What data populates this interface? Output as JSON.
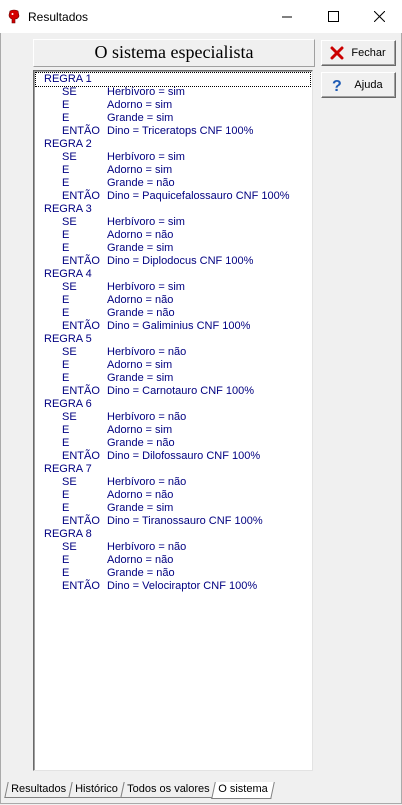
{
  "window": {
    "title": "Resultados"
  },
  "panel": {
    "heading": "O sistema especialista"
  },
  "buttons": {
    "close_label": "Fechar",
    "help_label": "Ajuda"
  },
  "tabs": [
    "Resultados",
    "Histórico",
    "Todos os valores",
    "O sistema"
  ],
  "colors": {
    "text_blue": "#000080",
    "close_x": "#cc0000",
    "help_q": "#1e5bb5"
  },
  "rules": [
    {
      "name": "REGRA 1",
      "if_kw": "SE",
      "and_kw": "E",
      "then_kw": "ENTÃO",
      "c1": "Herbívoro = sim",
      "c2": "Adorno = sim",
      "c3": "Grande = sim",
      "result": "Dino = Triceratops CNF 100%"
    },
    {
      "name": "REGRA 2",
      "if_kw": "SE",
      "and_kw": "E",
      "then_kw": "ENTÃO",
      "c1": "Herbívoro = sim",
      "c2": "Adorno = sim",
      "c3": "Grande = não",
      "result": "Dino = Paquicefalossauro CNF 100%"
    },
    {
      "name": "REGRA 3",
      "if_kw": "SE",
      "and_kw": "E",
      "then_kw": "ENTÃO",
      "c1": "Herbívoro = sim",
      "c2": "Adorno = não",
      "c3": "Grande = sim",
      "result": "Dino = Diplodocus CNF 100%"
    },
    {
      "name": "REGRA 4",
      "if_kw": "SE",
      "and_kw": "E",
      "then_kw": "ENTÃO",
      "c1": "Herbívoro = sim",
      "c2": "Adorno = não",
      "c3": "Grande = não",
      "result": "Dino = Galiminius CNF 100%"
    },
    {
      "name": "REGRA 5",
      "if_kw": "SE",
      "and_kw": "E",
      "then_kw": "ENTÃO",
      "c1": "Herbívoro = não",
      "c2": "Adorno = sim",
      "c3": "Grande = sim",
      "result": "Dino = Carnotauro CNF 100%"
    },
    {
      "name": "REGRA 6",
      "if_kw": "SE",
      "and_kw": "E",
      "then_kw": "ENTÃO",
      "c1": "Herbívoro = não",
      "c2": "Adorno = sim",
      "c3": "Grande = não",
      "result": "Dino = Dilofossauro CNF 100%"
    },
    {
      "name": "REGRA 7",
      "if_kw": "SE",
      "and_kw": "E",
      "then_kw": "ENTÃO",
      "c1": "Herbívoro = não",
      "c2": "Adorno = não",
      "c3": "Grande = sim",
      "result": "Dino = Tiranossauro CNF 100%"
    },
    {
      "name": "REGRA 8",
      "if_kw": "SE",
      "and_kw": "E",
      "then_kw": "ENTÃO",
      "c1": "Herbívoro = não",
      "c2": "Adorno = não",
      "c3": "Grande = não",
      "result": "Dino = Velociraptor CNF 100%"
    }
  ]
}
